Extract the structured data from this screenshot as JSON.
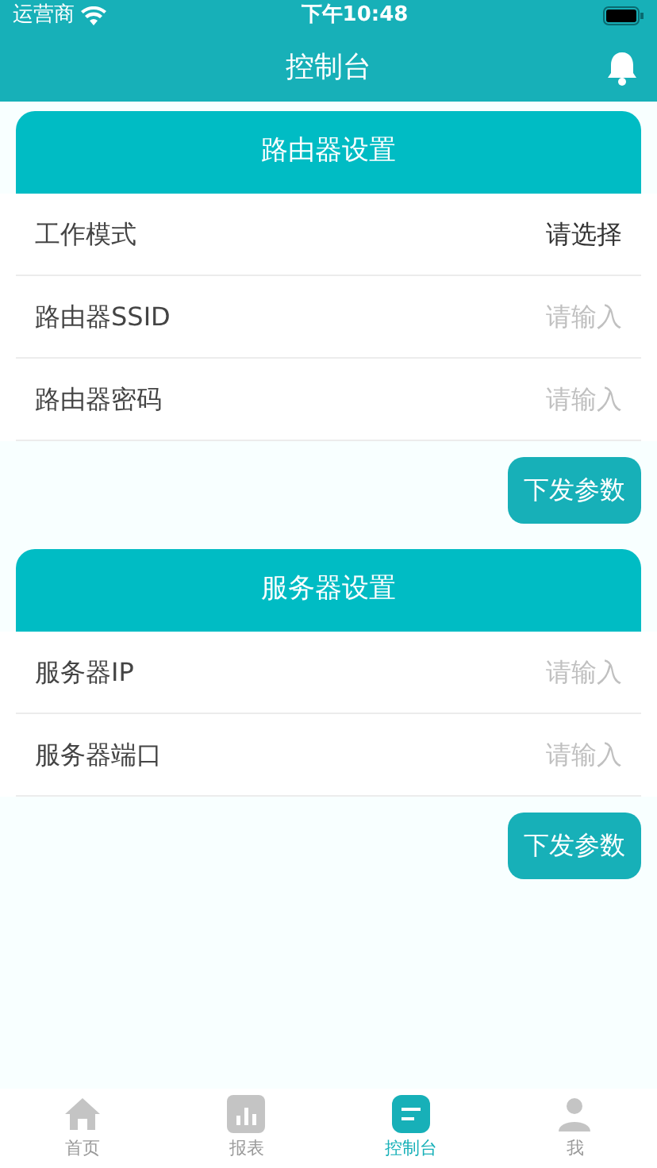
{
  "status_bar": {
    "carrier": "运营商",
    "time": "下午10:48"
  },
  "nav": {
    "title": "控制台"
  },
  "sections": [
    {
      "title": "路由器设置",
      "rows": [
        {
          "kind": "select",
          "label": "工作模式",
          "value": "请选择"
        },
        {
          "kind": "input",
          "label": "路由器SSID",
          "placeholder": "请输入"
        },
        {
          "kind": "input",
          "label": "路由器密码",
          "placeholder": "请输入"
        }
      ],
      "button": "下发参数"
    },
    {
      "title": "服务器设置",
      "rows": [
        {
          "kind": "input",
          "label": "服务器IP",
          "placeholder": "请输入"
        },
        {
          "kind": "input",
          "label": "服务器端口",
          "placeholder": "请输入"
        }
      ],
      "button": "下发参数"
    }
  ],
  "tabs": [
    {
      "label": "首页",
      "kind": "home",
      "selected": false
    },
    {
      "label": "报表",
      "kind": "chart",
      "selected": false
    },
    {
      "label": "控制台",
      "kind": "console",
      "selected": true
    },
    {
      "label": "我",
      "kind": "user",
      "selected": false
    }
  ]
}
